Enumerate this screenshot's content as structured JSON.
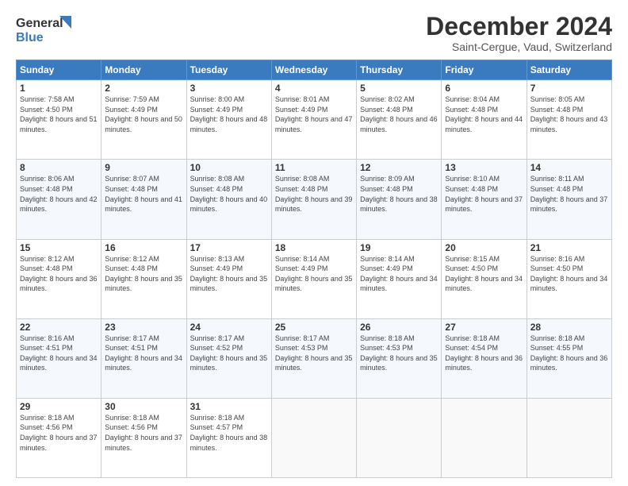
{
  "header": {
    "logo_line1": "General",
    "logo_line2": "Blue",
    "title": "December 2024",
    "subtitle": "Saint-Cergue, Vaud, Switzerland"
  },
  "weekdays": [
    "Sunday",
    "Monday",
    "Tuesday",
    "Wednesday",
    "Thursday",
    "Friday",
    "Saturday"
  ],
  "weeks": [
    [
      {
        "day": "1",
        "sunrise": "Sunrise: 7:58 AM",
        "sunset": "Sunset: 4:50 PM",
        "daylight": "Daylight: 8 hours and 51 minutes."
      },
      {
        "day": "2",
        "sunrise": "Sunrise: 7:59 AM",
        "sunset": "Sunset: 4:49 PM",
        "daylight": "Daylight: 8 hours and 50 minutes."
      },
      {
        "day": "3",
        "sunrise": "Sunrise: 8:00 AM",
        "sunset": "Sunset: 4:49 PM",
        "daylight": "Daylight: 8 hours and 48 minutes."
      },
      {
        "day": "4",
        "sunrise": "Sunrise: 8:01 AM",
        "sunset": "Sunset: 4:49 PM",
        "daylight": "Daylight: 8 hours and 47 minutes."
      },
      {
        "day": "5",
        "sunrise": "Sunrise: 8:02 AM",
        "sunset": "Sunset: 4:48 PM",
        "daylight": "Daylight: 8 hours and 46 minutes."
      },
      {
        "day": "6",
        "sunrise": "Sunrise: 8:04 AM",
        "sunset": "Sunset: 4:48 PM",
        "daylight": "Daylight: 8 hours and 44 minutes."
      },
      {
        "day": "7",
        "sunrise": "Sunrise: 8:05 AM",
        "sunset": "Sunset: 4:48 PM",
        "daylight": "Daylight: 8 hours and 43 minutes."
      }
    ],
    [
      {
        "day": "8",
        "sunrise": "Sunrise: 8:06 AM",
        "sunset": "Sunset: 4:48 PM",
        "daylight": "Daylight: 8 hours and 42 minutes."
      },
      {
        "day": "9",
        "sunrise": "Sunrise: 8:07 AM",
        "sunset": "Sunset: 4:48 PM",
        "daylight": "Daylight: 8 hours and 41 minutes."
      },
      {
        "day": "10",
        "sunrise": "Sunrise: 8:08 AM",
        "sunset": "Sunset: 4:48 PM",
        "daylight": "Daylight: 8 hours and 40 minutes."
      },
      {
        "day": "11",
        "sunrise": "Sunrise: 8:08 AM",
        "sunset": "Sunset: 4:48 PM",
        "daylight": "Daylight: 8 hours and 39 minutes."
      },
      {
        "day": "12",
        "sunrise": "Sunrise: 8:09 AM",
        "sunset": "Sunset: 4:48 PM",
        "daylight": "Daylight: 8 hours and 38 minutes."
      },
      {
        "day": "13",
        "sunrise": "Sunrise: 8:10 AM",
        "sunset": "Sunset: 4:48 PM",
        "daylight": "Daylight: 8 hours and 37 minutes."
      },
      {
        "day": "14",
        "sunrise": "Sunrise: 8:11 AM",
        "sunset": "Sunset: 4:48 PM",
        "daylight": "Daylight: 8 hours and 37 minutes."
      }
    ],
    [
      {
        "day": "15",
        "sunrise": "Sunrise: 8:12 AM",
        "sunset": "Sunset: 4:48 PM",
        "daylight": "Daylight: 8 hours and 36 minutes."
      },
      {
        "day": "16",
        "sunrise": "Sunrise: 8:12 AM",
        "sunset": "Sunset: 4:48 PM",
        "daylight": "Daylight: 8 hours and 35 minutes."
      },
      {
        "day": "17",
        "sunrise": "Sunrise: 8:13 AM",
        "sunset": "Sunset: 4:49 PM",
        "daylight": "Daylight: 8 hours and 35 minutes."
      },
      {
        "day": "18",
        "sunrise": "Sunrise: 8:14 AM",
        "sunset": "Sunset: 4:49 PM",
        "daylight": "Daylight: 8 hours and 35 minutes."
      },
      {
        "day": "19",
        "sunrise": "Sunrise: 8:14 AM",
        "sunset": "Sunset: 4:49 PM",
        "daylight": "Daylight: 8 hours and 34 minutes."
      },
      {
        "day": "20",
        "sunrise": "Sunrise: 8:15 AM",
        "sunset": "Sunset: 4:50 PM",
        "daylight": "Daylight: 8 hours and 34 minutes."
      },
      {
        "day": "21",
        "sunrise": "Sunrise: 8:16 AM",
        "sunset": "Sunset: 4:50 PM",
        "daylight": "Daylight: 8 hours and 34 minutes."
      }
    ],
    [
      {
        "day": "22",
        "sunrise": "Sunrise: 8:16 AM",
        "sunset": "Sunset: 4:51 PM",
        "daylight": "Daylight: 8 hours and 34 minutes."
      },
      {
        "day": "23",
        "sunrise": "Sunrise: 8:17 AM",
        "sunset": "Sunset: 4:51 PM",
        "daylight": "Daylight: 8 hours and 34 minutes."
      },
      {
        "day": "24",
        "sunrise": "Sunrise: 8:17 AM",
        "sunset": "Sunset: 4:52 PM",
        "daylight": "Daylight: 8 hours and 35 minutes."
      },
      {
        "day": "25",
        "sunrise": "Sunrise: 8:17 AM",
        "sunset": "Sunset: 4:53 PM",
        "daylight": "Daylight: 8 hours and 35 minutes."
      },
      {
        "day": "26",
        "sunrise": "Sunrise: 8:18 AM",
        "sunset": "Sunset: 4:53 PM",
        "daylight": "Daylight: 8 hours and 35 minutes."
      },
      {
        "day": "27",
        "sunrise": "Sunrise: 8:18 AM",
        "sunset": "Sunset: 4:54 PM",
        "daylight": "Daylight: 8 hours and 36 minutes."
      },
      {
        "day": "28",
        "sunrise": "Sunrise: 8:18 AM",
        "sunset": "Sunset: 4:55 PM",
        "daylight": "Daylight: 8 hours and 36 minutes."
      }
    ],
    [
      {
        "day": "29",
        "sunrise": "Sunrise: 8:18 AM",
        "sunset": "Sunset: 4:56 PM",
        "daylight": "Daylight: 8 hours and 37 minutes."
      },
      {
        "day": "30",
        "sunrise": "Sunrise: 8:18 AM",
        "sunset": "Sunset: 4:56 PM",
        "daylight": "Daylight: 8 hours and 37 minutes."
      },
      {
        "day": "31",
        "sunrise": "Sunrise: 8:18 AM",
        "sunset": "Sunset: 4:57 PM",
        "daylight": "Daylight: 8 hours and 38 minutes."
      },
      null,
      null,
      null,
      null
    ]
  ]
}
